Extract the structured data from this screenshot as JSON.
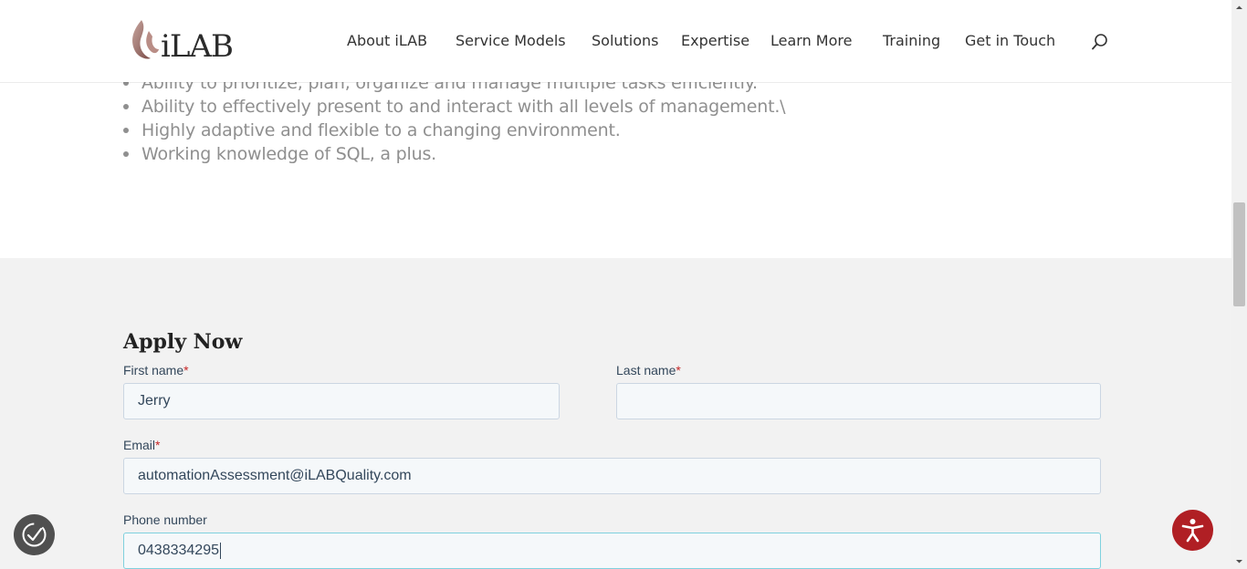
{
  "header": {
    "logo_text": "iLAB",
    "nav": [
      "About iLAB",
      "Service Models",
      "Solutions",
      "Expertise",
      "Learn More",
      "Training",
      "Get in Touch"
    ]
  },
  "requirements": [
    "Ability to prioritize, plan, organize and manage multiple tasks efficiently.",
    "Ability to effectively present to and interact with all levels of management.\\",
    "Highly adaptive and flexible to a changing environment.",
    "Working knowledge of SQL, a plus."
  ],
  "form": {
    "title": "Apply Now",
    "required_marker": "*",
    "first_name": {
      "label": "First name",
      "value": "Jerry"
    },
    "last_name": {
      "label": "Last name",
      "value": ""
    },
    "email": {
      "label": "Email",
      "value": "automationAssessment@iLABQuality.com"
    },
    "phone": {
      "label": "Phone number",
      "value": "0438334295"
    }
  },
  "colors": {
    "accent": "#b01f24",
    "required": "#c62828",
    "field_bg": "#f5f8fa",
    "section_bg": "#f2f2f2"
  }
}
